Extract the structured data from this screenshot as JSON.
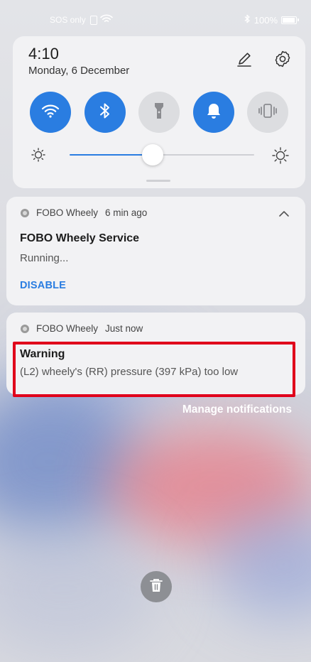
{
  "status_bar": {
    "carrier": "SOS only",
    "battery": "100%",
    "battery_level": 1.0
  },
  "quick_settings": {
    "time": "4:10",
    "date": "Monday, 6 December",
    "brightness_level": 0.45,
    "tiles": [
      {
        "name": "wifi",
        "icon": "wifi-icon",
        "active": true
      },
      {
        "name": "bluetooth",
        "icon": "bluetooth-icon",
        "active": true
      },
      {
        "name": "flashlight",
        "icon": "flashlight-icon",
        "active": false
      },
      {
        "name": "sound",
        "icon": "bell-icon",
        "active": true
      },
      {
        "name": "vibrate",
        "icon": "vibrate-icon",
        "active": false
      }
    ]
  },
  "notifications": [
    {
      "app": "FOBO Wheely",
      "time": "6 min ago",
      "title": "FOBO Wheely Service",
      "body": "Running...",
      "action": "DISABLE"
    },
    {
      "app": "FOBO Wheely",
      "time": "Just now",
      "title": "Warning",
      "body": "(L2) wheely's (RR) pressure (397 kPa) too low"
    }
  ],
  "manage_label": "Manage notifications",
  "colors": {
    "accent": "#2a7de1",
    "highlight": "#e0001b",
    "card": "#f2f2f4"
  }
}
